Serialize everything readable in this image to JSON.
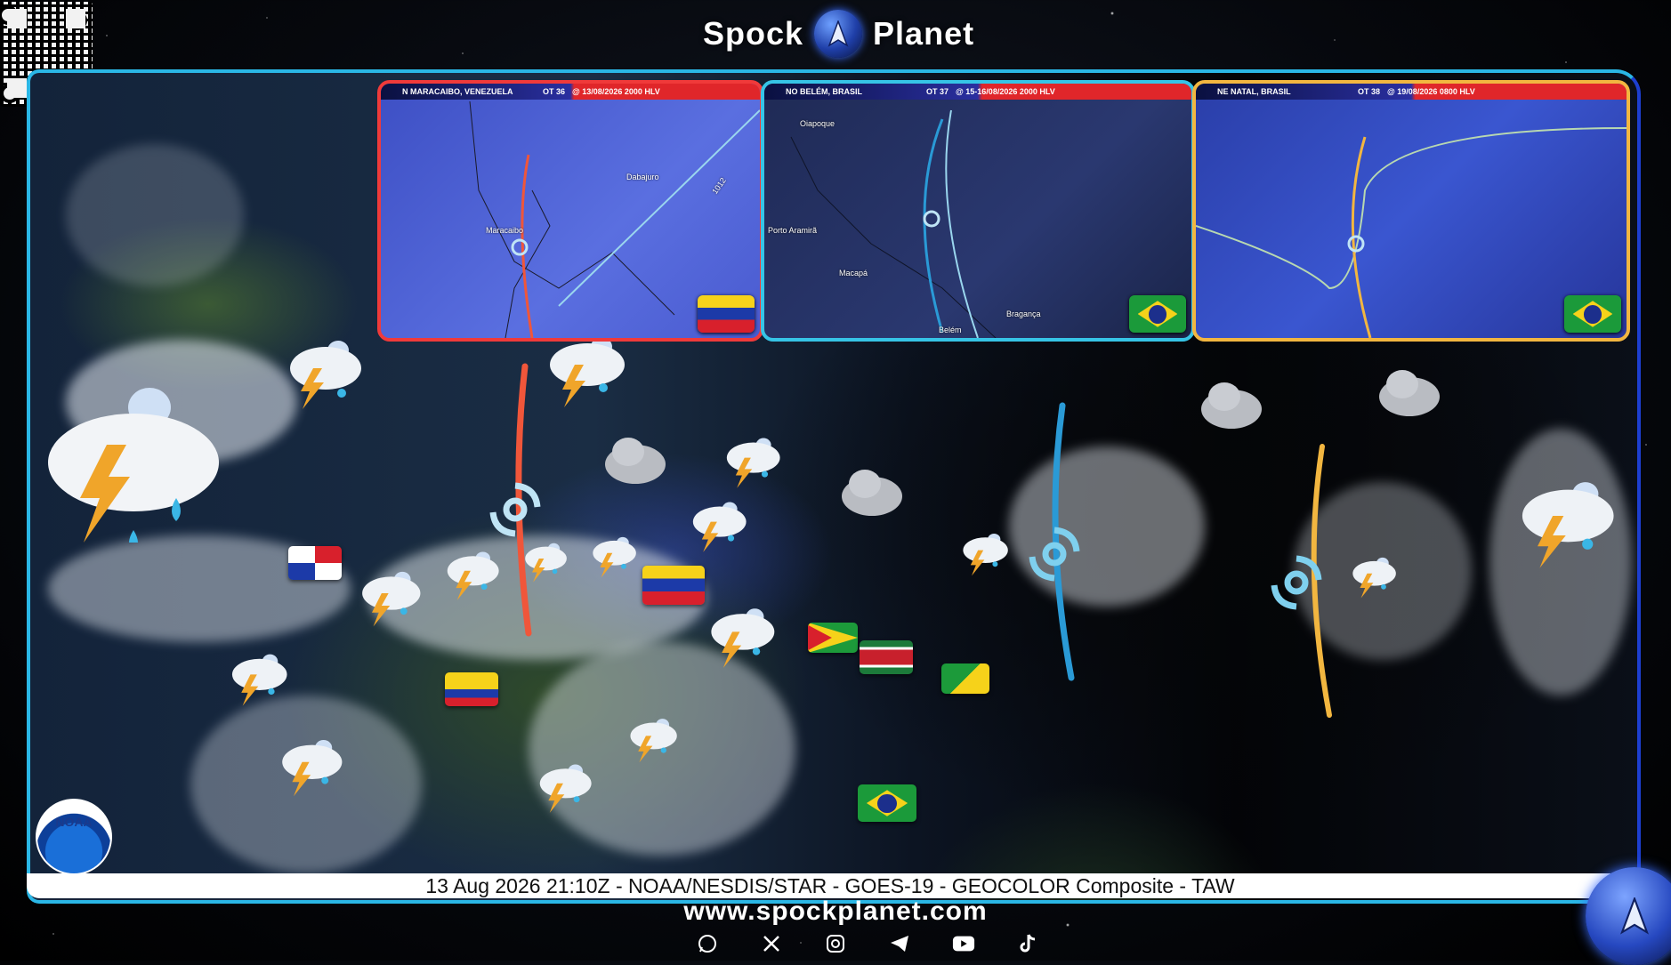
{
  "header": {
    "brand_left": "Spock",
    "brand_right": "Planet"
  },
  "insets": [
    {
      "place": "N MARACAIBO, VENEZUELA",
      "ot": "OT 36",
      "date": "@ 13/08/2026 2000 HLV",
      "labels": [
        "Dabajuro",
        "Maracaibo",
        "1012"
      ],
      "flag": "venezuela"
    },
    {
      "place": "NO BELÉM, BRASIL",
      "ot": "OT 37",
      "date": "@ 15-16/08/2026 2000 HLV",
      "labels": [
        "Oiapoque",
        "Porto Aramirã",
        "Macapá",
        "Belém",
        "Bragança"
      ],
      "flag": "brazil"
    },
    {
      "place": "NE NATAL, BRASIL",
      "ot": "OT 38",
      "date": "@ 19/08/2026 0800 HLV",
      "labels": [],
      "flag": "brazil"
    }
  ],
  "caption": "13 Aug 2026 21:10Z - NOAA/NESDIS/STAR - GOES-19 - GEOCOLOR Composite - TAW",
  "logo": {
    "noaa": "NOAA"
  },
  "footer": {
    "url": "www.spockplanet.com"
  },
  "social_icons": [
    "whatsapp-icon",
    "x-icon",
    "instagram-icon",
    "telegram-icon",
    "youtube-icon",
    "tiktok-icon"
  ],
  "colors": {
    "ot36": "#f0563a",
    "ot37": "#36c4e6",
    "ot38": "#f2b640",
    "frame": "#2ab7e6"
  }
}
